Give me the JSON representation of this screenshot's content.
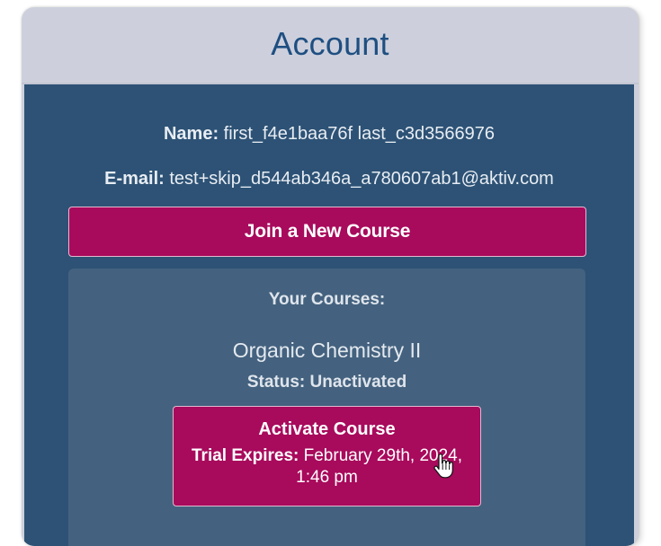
{
  "header": {
    "title": "Account"
  },
  "profile": {
    "name_label": "Name:",
    "name_value": "first_f4e1baa76f last_c3d3566976",
    "email_label": "E-mail:",
    "email_value": "test+skip_d544ab346a_a780607ab1@aktiv.com"
  },
  "actions": {
    "join_label": "Join a New Course"
  },
  "courses": {
    "section_title": "Your Courses:",
    "items": [
      {
        "name": "Organic Chemistry II",
        "status_text": "Status: Unactivated",
        "activate_label": "Activate Course",
        "trial_label": "Trial Expires:",
        "trial_value": "February 29th, 2024, 1:46 pm"
      }
    ]
  },
  "colors": {
    "header_bg": "#cdd0dc",
    "title": "#1e4f82",
    "body_bg": "#2d5275",
    "panel_bg": "#44627f",
    "accent": "#a80a5c"
  },
  "icons": {
    "cursor": "hand-pointer-cursor-icon"
  }
}
